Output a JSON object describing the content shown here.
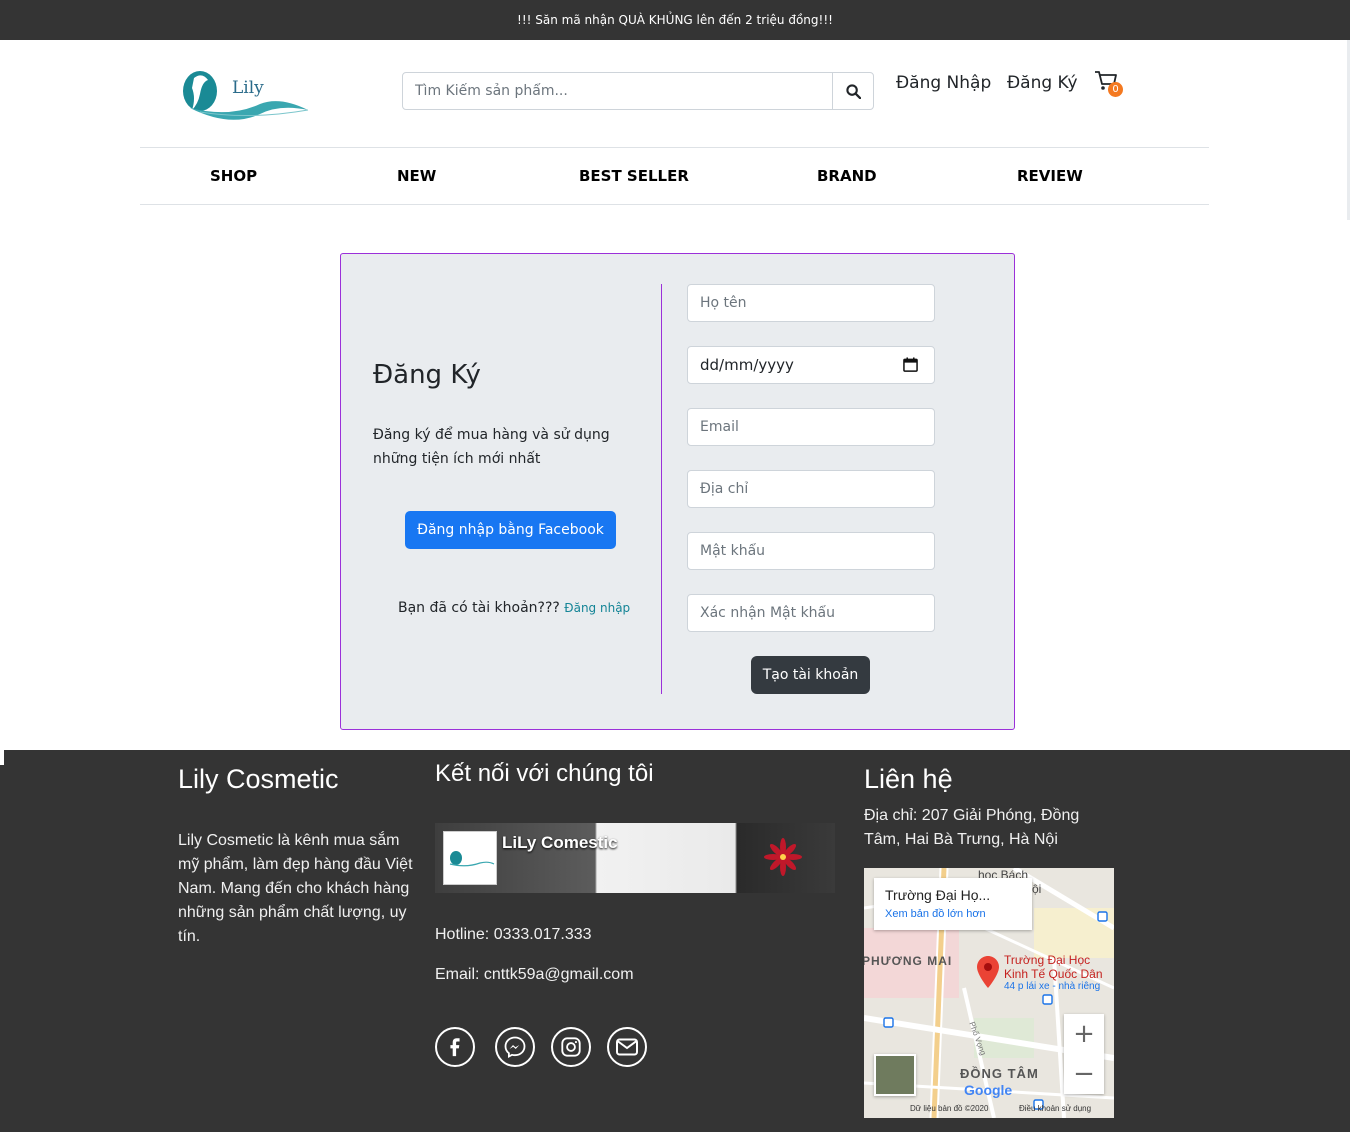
{
  "promo": "!!! Săn mã nhận QUÀ KHỦNG lên đến 2 triệu đồng!!!",
  "header": {
    "logo_text": "Lily",
    "search_placeholder": "Tìm Kiếm sản phẩm...",
    "login": "Đăng Nhập",
    "register": "Đăng Ký",
    "cart_count": "0"
  },
  "nav": [
    "SHOP",
    "NEW",
    "BEST SELLER",
    "BRAND",
    "REVIEW"
  ],
  "signup": {
    "title": "Đăng Ký",
    "description": "Đăng ký để mua hàng và sử dụng những tiện ích mới nhất",
    "facebook_button": "Đăng nhập bằng Facebook",
    "have_account": "Bạn đã có tài khoản???",
    "login_link": "Đăng nhập",
    "fields": {
      "name_placeholder": "Họ tên",
      "dob_value": "dd/mm/yyyy",
      "email_placeholder": "Email",
      "address_placeholder": "Địa chỉ",
      "password_placeholder": "Mật khẩu",
      "confirm_placeholder": "Xác nhận Mật khẩu"
    },
    "submit": "Tạo tài khoản"
  },
  "footer": {
    "about_title": "Lily Cosmetic",
    "about_text": "Lily Cosmetic là kênh mua sắm mỹ phẩm, làm đẹp hàng đầu Việt Nam. Mang đến cho khách hàng những sản phẩm chất lượng, uy tín.",
    "connect_title": "Kết nối với chúng tôi",
    "fb_page_name": "LiLy Comestic",
    "hotline": "Hotline: 0333.017.333",
    "email": "Email: cnttk59a@gmail.com",
    "social_icons": [
      "facebook-icon",
      "messenger-icon",
      "instagram-icon",
      "mail-icon"
    ],
    "contact_title": "Liên hệ",
    "address": "Địa chỉ: 207 Giải Phóng, Đồng Tâm, Hai Bà Trưng, Hà Nội",
    "map": {
      "place_title": "Trường Đại Họ...",
      "larger_map": "Xem bản đồ lớn hơn",
      "marker_label_1": "Trường Đại Học",
      "marker_label_2": "Kinh Tế Quốc Dân",
      "sub_label": "44 p lái xe - nhà riêng",
      "district_1": "PHƯƠNG MAI",
      "district_2": "ĐỒNG TÂM",
      "top_label": "học Bách",
      "top_label_2": "ội",
      "street": "Phố Vọng",
      "google": "Google",
      "map_data": "Dữ liệu bản đồ ©2020",
      "terms": "Điều khoản sử dụng",
      "zoom_in": "+",
      "zoom_out": "−"
    }
  },
  "colors": {
    "dark": "#343434",
    "accent_border": "#9b30d9",
    "facebook": "#1877f2",
    "badge": "#f47920",
    "link": "#138496"
  }
}
